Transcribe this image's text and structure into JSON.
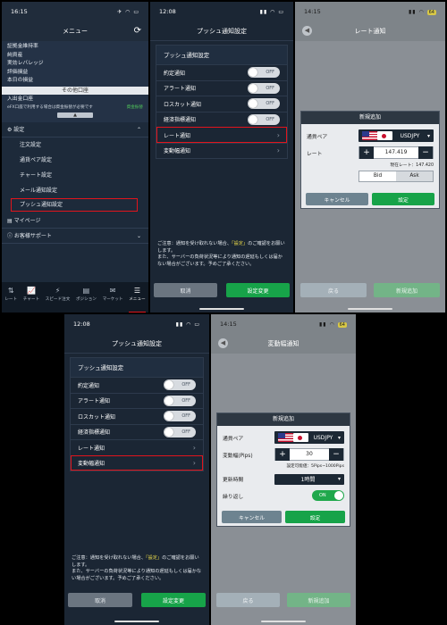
{
  "screen1": {
    "time": "16:15",
    "title": "メニュー",
    "account_rows": [
      "証拠金維持率",
      "純資産",
      "実効レバレッジ",
      "評価損益",
      "本日の損益"
    ],
    "other_section": "その他口座",
    "entry_label": "入出金口座",
    "note_text": "eFX口座で利用する場合は資金振替が必要です",
    "note_link": "資金振替",
    "up_arrow": "▲",
    "settings_label": "設定",
    "settings_chevron": "⌃",
    "sub_items": [
      "注文設定",
      "通貨ペア設定",
      "チャート設定",
      "メール通知設定",
      "プッシュ通知設定"
    ],
    "mypage": "マイページ",
    "support": "お客様サポート",
    "support_chevron": "⌄",
    "tabs": [
      {
        "icon": "⇅",
        "label": "レート"
      },
      {
        "icon": "📈",
        "label": "チャート"
      },
      {
        "icon": "⚡",
        "label": "スピード注文"
      },
      {
        "icon": "▤",
        "label": "ポジション"
      },
      {
        "icon": "✉",
        "label": "マーケット"
      },
      {
        "icon": "☰",
        "label": "メニュー"
      }
    ]
  },
  "screen2": {
    "time": "12:08",
    "title": "プッシュ通知設定",
    "panel_title": "プッシュ通知設定",
    "toggle_rows": [
      {
        "label": "約定通知",
        "state": "OFF"
      },
      {
        "label": "アラート通知",
        "state": "OFF"
      },
      {
        "label": "ロスカット通知",
        "state": "OFF"
      },
      {
        "label": "経済指標通知",
        "state": "OFF"
      }
    ],
    "link_rows": [
      "レート通知",
      "変動幅通知"
    ],
    "notice_a": "ご注意：通知を受け取れない場合、",
    "notice_hl": "「設定」",
    "notice_b": "のご確認をお願いします。",
    "notice_c": "また、サーバーの負荷状況等により通知の遅延もしくは届かない場合がございます。予めご了承ください。",
    "cancel": "取消",
    "save": "設定変更"
  },
  "screen3": {
    "time": "14:15",
    "battery": "64",
    "title": "レート通知",
    "dialog_title": "新規追加",
    "pair_label": "通貨ペア",
    "pair_value": "USDJPY",
    "rate_label": "レート",
    "rate_value": "147.419",
    "current_rate": "現在レート：147.420",
    "bid": "Bid",
    "ask": "Ask",
    "cancel": "キャンセル",
    "confirm": "設定",
    "back": "戻る",
    "add": "新規追加"
  },
  "screen4": {
    "time": "12:08",
    "title": "プッシュ通知設定",
    "panel_title": "プッシュ通知設定",
    "toggle_rows": [
      {
        "label": "約定通知",
        "state": "OFF"
      },
      {
        "label": "アラート通知",
        "state": "OFF"
      },
      {
        "label": "ロスカット通知",
        "state": "OFF"
      },
      {
        "label": "経済指標通知",
        "state": "OFF"
      }
    ],
    "link_rows": [
      "レート通知",
      "変動幅通知"
    ],
    "notice_a": "ご注意：通知を受け取れない場合、",
    "notice_hl": "「設定」",
    "notice_b": "のご確認をお願いします。",
    "notice_c": "また、サーバーの負荷状況等により通知の遅延もしくは届かない場合がございます。予めご了承ください。",
    "cancel": "取消",
    "save": "設定変更"
  },
  "screen5": {
    "time": "14:15",
    "battery": "64",
    "title": "変動幅通知",
    "dialog_title": "新規追加",
    "pair_label": "通貨ペア",
    "pair_value": "USDJPY",
    "range_label": "変動幅(Pips)",
    "range_value": "30",
    "range_hint": "設定可能値：5Pips~1000Pips",
    "period_label": "更新時間",
    "period_value": "1時間",
    "repeat_label": "繰り返し",
    "repeat_state": "ON",
    "cancel": "キャンセル",
    "confirm": "設定",
    "back": "戻る",
    "add": "新規追加"
  },
  "colors": {
    "highlight": "#e2141c",
    "primary": "#17a349",
    "notice_highlight": "#e8d84a"
  },
  "icons": [
    "reload-icon",
    "back-icon",
    "chevron-right-icon",
    "plus-icon",
    "minus-icon",
    "caret-down-icon"
  ]
}
